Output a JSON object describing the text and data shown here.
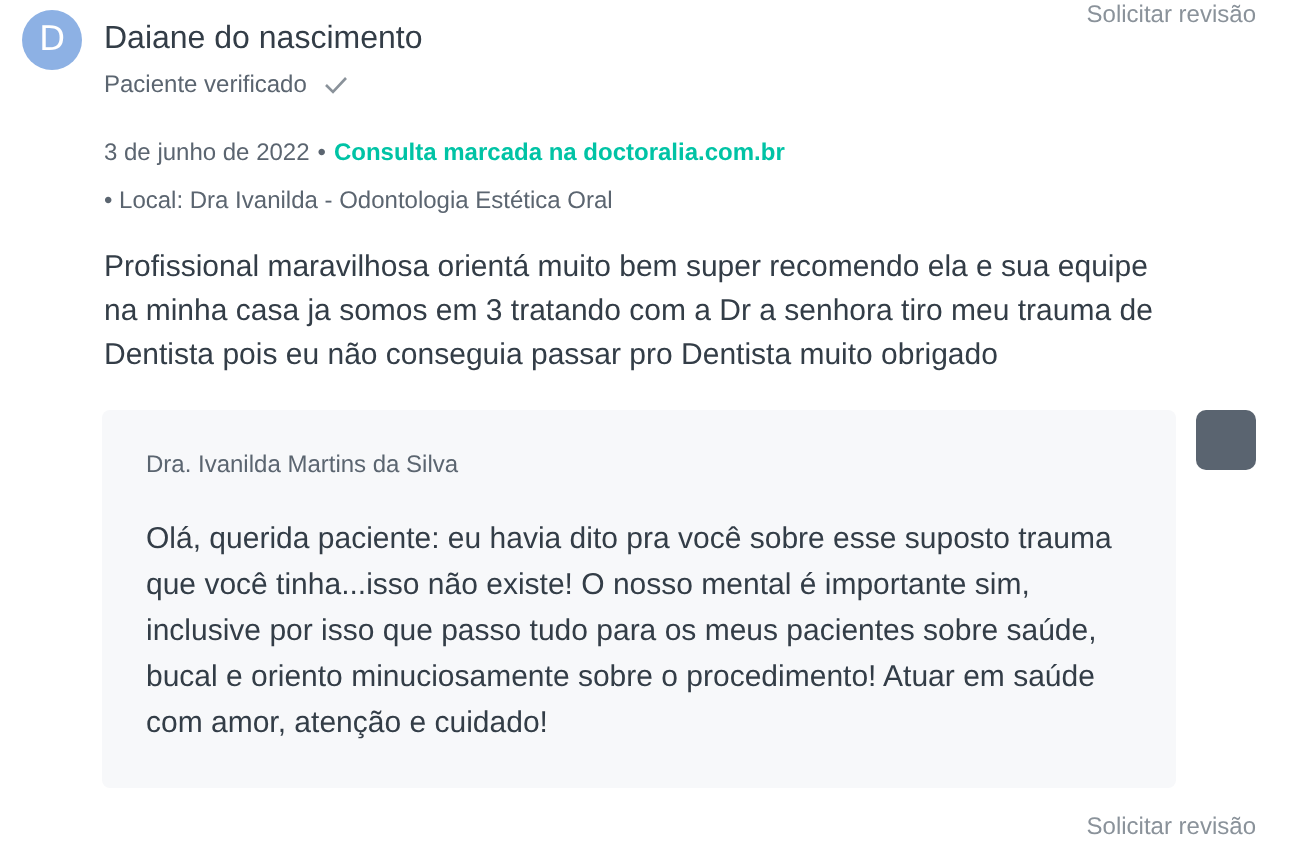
{
  "top_link": "Solicitar revisão",
  "review": {
    "avatar_letter": "D",
    "author": "Daiane do nascimento",
    "verified_label": "Paciente verificado",
    "verified": true,
    "date": "3 de junho de 2022",
    "separator": "•",
    "booking_note": "Consulta marcada na doctoralia.com.br",
    "location": "• Local: Dra Ivanilda - Odontologia Estética Oral",
    "text": "Profissional maravilhosa orientá muito bem super recomendo ela e sua equipe na minha casa ja somos em 3 tratando com a Dr a senhora tiro meu trauma de Dentista pois eu não conseguia passar pro Dentista muito obrigado"
  },
  "reply": {
    "author": "Dra. Ivanilda Martins da Silva",
    "text": "Olá, querida paciente: eu havia dito pra você sobre esse suposto trauma que você tinha...isso não existe! O nosso mental é importante sim, inclusive por isso que passo tudo para os meus pacientes sobre saúde, bucal e oriento minuciosamente sobre o procedimento! Atuar em saúde com amor, atenção e cuidado!"
  },
  "bottom_link": "Solicitar revisão"
}
